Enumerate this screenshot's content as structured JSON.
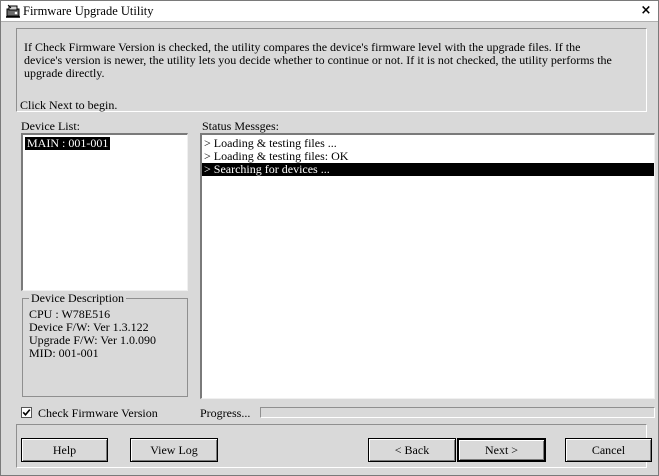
{
  "window": {
    "title": "Firmware Upgrade Utility",
    "close_glyph": "×",
    "icon": "firmware-utility-icon"
  },
  "intro": {
    "text": "If Check Firmware Version is checked, the utility compares the device's firmware level with the upgrade files. If the device's version is newer, the utility lets you decide whether to continue or not. If it is not checked, the utility performs the upgrade directly.",
    "begin": "Click Next to begin."
  },
  "device_list": {
    "label": "Device List:",
    "items": [
      {
        "label": "MAIN : 001-001",
        "selected": true
      }
    ]
  },
  "status": {
    "label": "Status Messges:",
    "lines": [
      {
        "text": "> Loading & testing files ...",
        "selected": false
      },
      {
        "text": "> Loading & testing files: OK",
        "selected": false
      },
      {
        "text": "> Searching for devices ...",
        "selected": true
      }
    ]
  },
  "device_description": {
    "legend": "Device Description",
    "cpu": "CPU : W78E516",
    "device_fw": "Device F/W: Ver 1.3.122",
    "upgrade_fw": "Upgrade F/W: Ver 1.0.090",
    "mid": "MID: 001-001"
  },
  "options": {
    "check_firmware_label": "Check Firmware Version",
    "check_firmware_checked": true
  },
  "progress": {
    "label": "Progress...",
    "value": 0
  },
  "buttons": {
    "help": "Help",
    "view_log": "View Log",
    "back": "< Back",
    "next": "Next >",
    "cancel": "Cancel"
  },
  "colors": {
    "window_bg": "#d9d9d9",
    "selection_bg": "#000000",
    "selection_fg": "#ffffff"
  }
}
